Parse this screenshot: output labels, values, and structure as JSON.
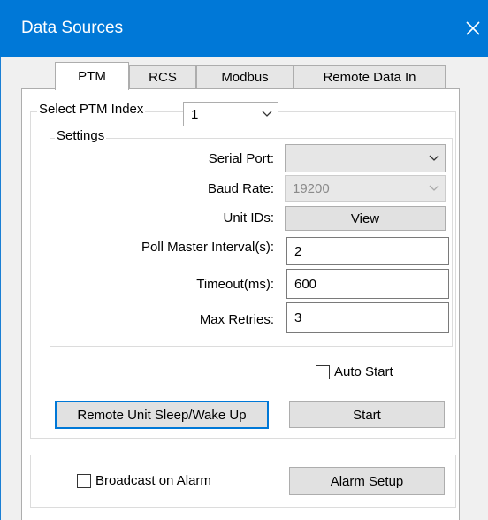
{
  "window": {
    "title": "Data Sources"
  },
  "tabs": [
    {
      "label": "PTM",
      "active": true
    },
    {
      "label": "RCS",
      "active": false
    },
    {
      "label": "Modbus",
      "active": false
    },
    {
      "label": "Remote Data In",
      "active": false
    }
  ],
  "ptm_index": {
    "label": "Select PTM Index",
    "value": "1"
  },
  "settings": {
    "label": "Settings",
    "serial_port": {
      "label": "Serial Port:",
      "value": ""
    },
    "baud_rate": {
      "label": "Baud Rate:",
      "value": "19200"
    },
    "unit_ids": {
      "label": "Unit IDs:",
      "button": "View"
    },
    "poll_interval": {
      "label": "Poll Master Interval(s):",
      "value": "2"
    },
    "timeout": {
      "label": "Timeout(ms):",
      "value": "600"
    },
    "max_retries": {
      "label": "Max Retries:",
      "value": "3"
    }
  },
  "auto_start": {
    "label": "Auto Start",
    "checked": false
  },
  "sleep_wake_button": "Remote Unit Sleep/Wake Up",
  "start_button": "Start",
  "broadcast_alarm": {
    "label": "Broadcast on Alarm",
    "checked": false
  },
  "alarm_setup_button": "Alarm Setup",
  "colors": {
    "titlebar": "#0078d7",
    "focus": "#0078d7"
  }
}
